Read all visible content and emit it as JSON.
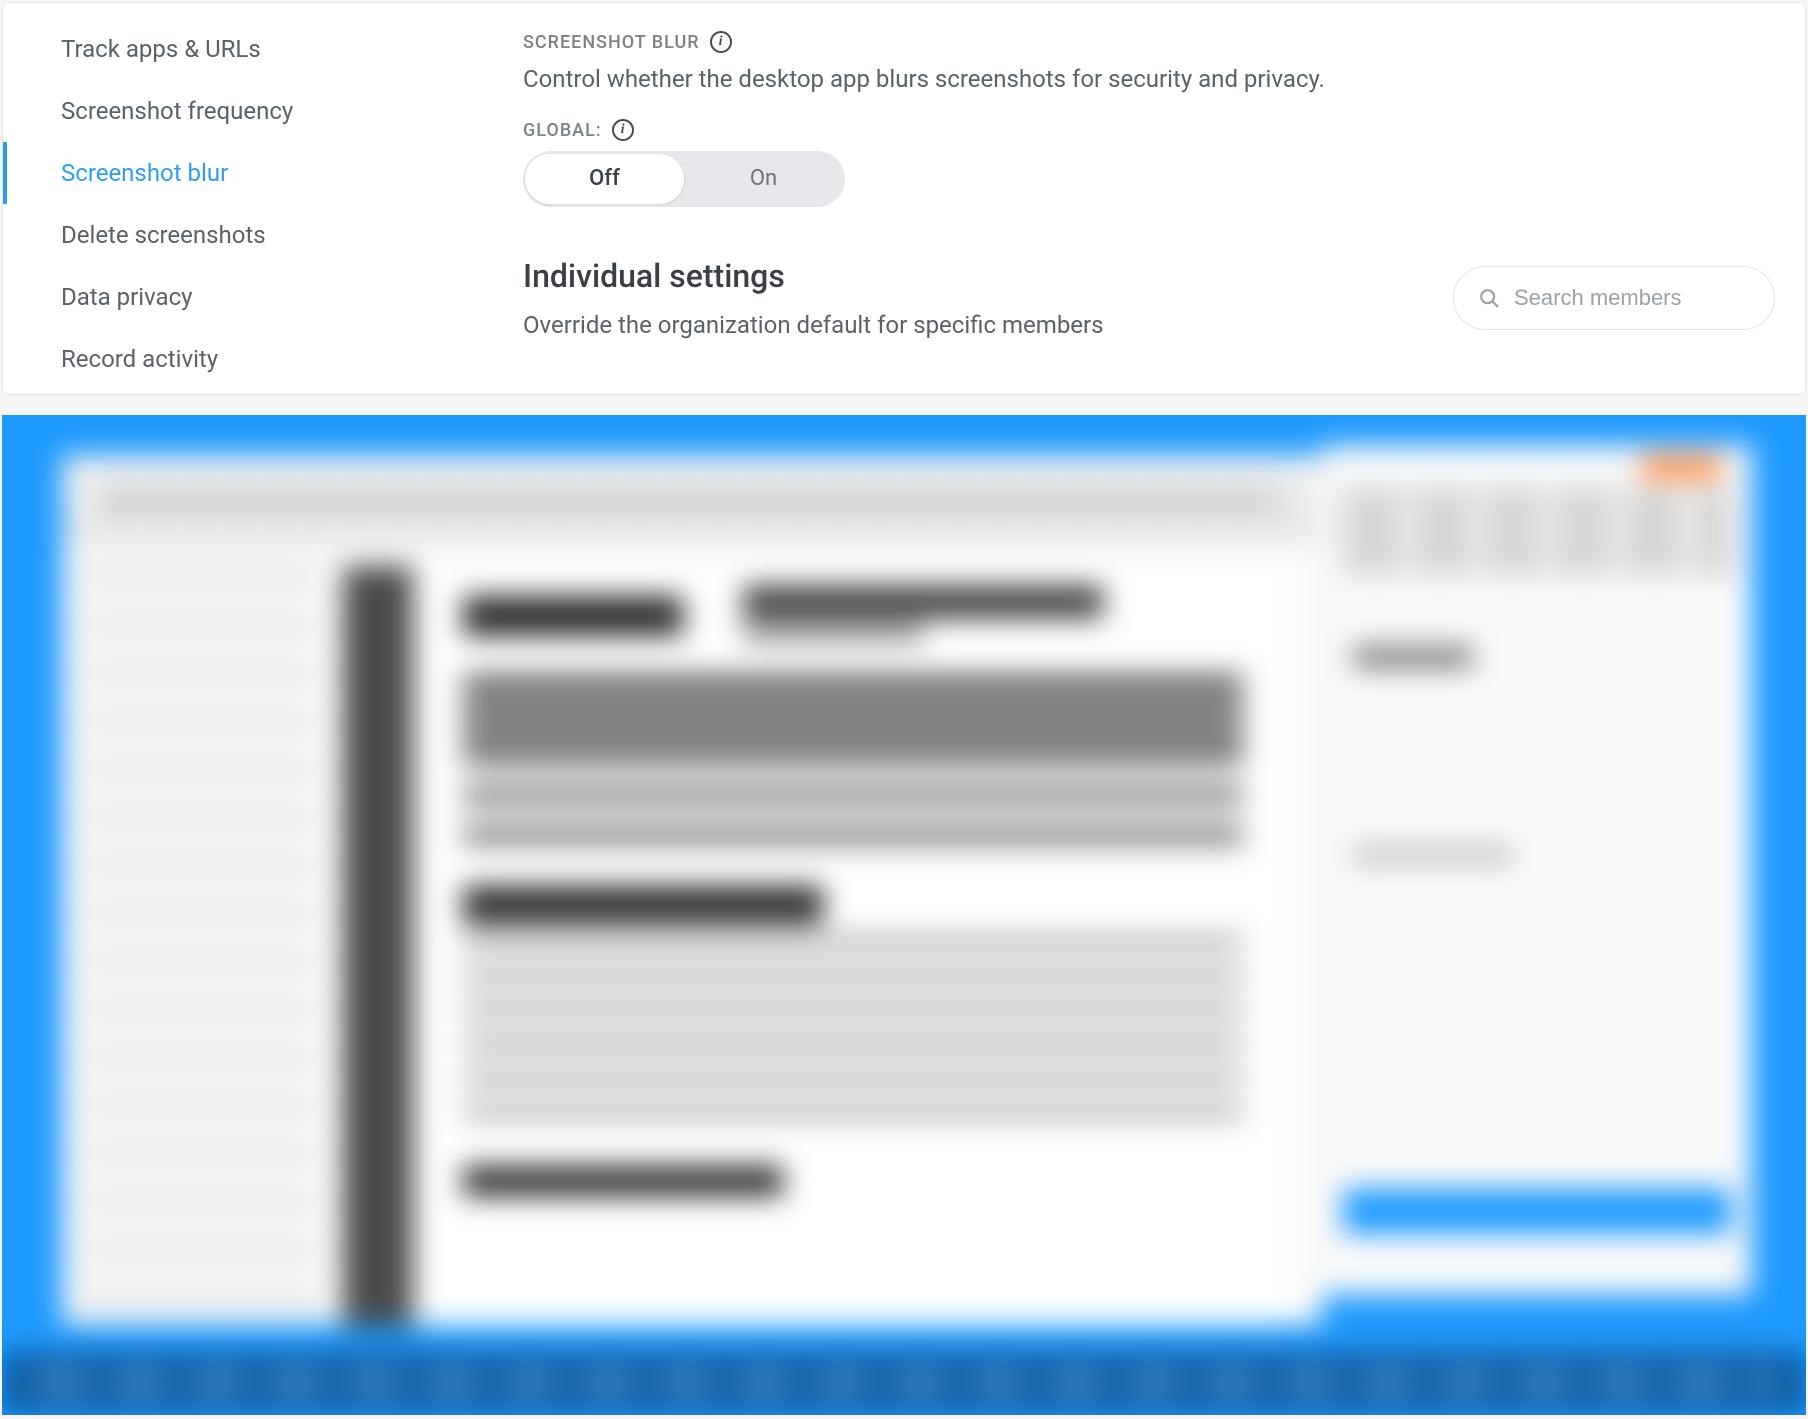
{
  "sidebar": {
    "items": [
      {
        "label": "Track apps & URLs"
      },
      {
        "label": "Screenshot frequency"
      },
      {
        "label": "Screenshot blur"
      },
      {
        "label": "Delete screenshots"
      },
      {
        "label": "Data privacy"
      },
      {
        "label": "Record activity"
      }
    ],
    "active_index": 2
  },
  "section": {
    "label": "SCREENSHOT BLUR",
    "description": "Control whether the desktop app blurs screenshots for security and privacy."
  },
  "global": {
    "label": "GLOBAL:",
    "toggle": {
      "off": "Off",
      "on": "On",
      "selected": "off"
    }
  },
  "individual": {
    "title": "Individual settings",
    "description": "Override the organization default for specific members"
  },
  "search": {
    "placeholder": "Search members"
  }
}
